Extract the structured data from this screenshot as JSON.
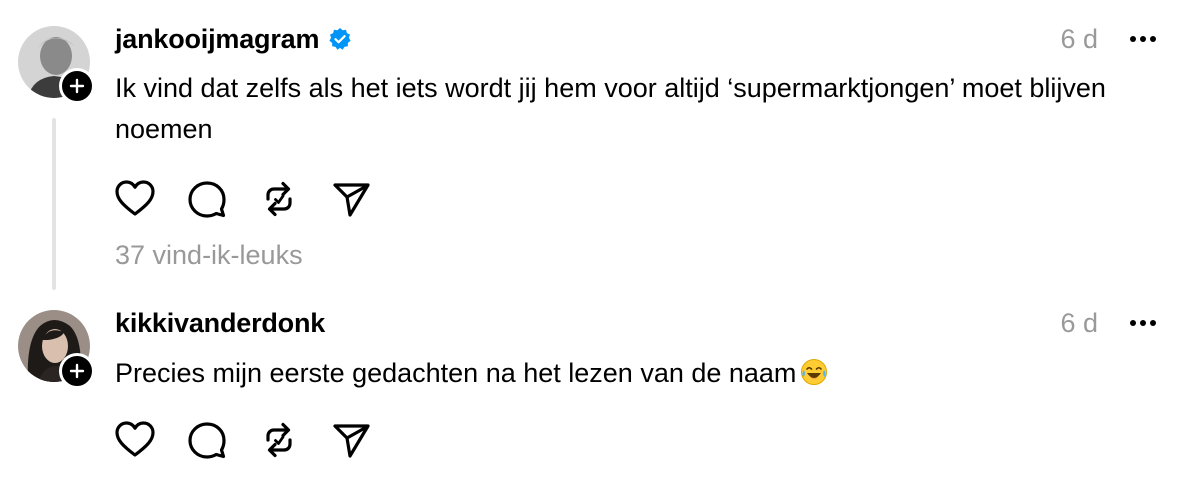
{
  "posts": [
    {
      "username": "jankooijmagram",
      "verified": true,
      "time": "6 d",
      "text": "Ik vind dat zelfs als het iets wordt jij hem voor altijd ‘supermarktjongen’ moet blijven noemen",
      "likes": "37 vind-ik-leuks"
    },
    {
      "username": "kikkivanderdonk",
      "verified": false,
      "time": "6 d",
      "text": "Precies mijn eerste gedachten na het lezen van de naam",
      "emoji": "face-with-tears-of-joy-icon"
    }
  ],
  "icons": {
    "like": "heart-icon",
    "reply": "comment-icon",
    "repost": "repost-icon",
    "share": "send-icon",
    "more": "more-icon",
    "verified": "verified-badge-icon",
    "follow": "plus-icon"
  },
  "colors": {
    "verified": "#0095f6",
    "muted": "#999999",
    "thread_line": "#e3e3e3"
  }
}
